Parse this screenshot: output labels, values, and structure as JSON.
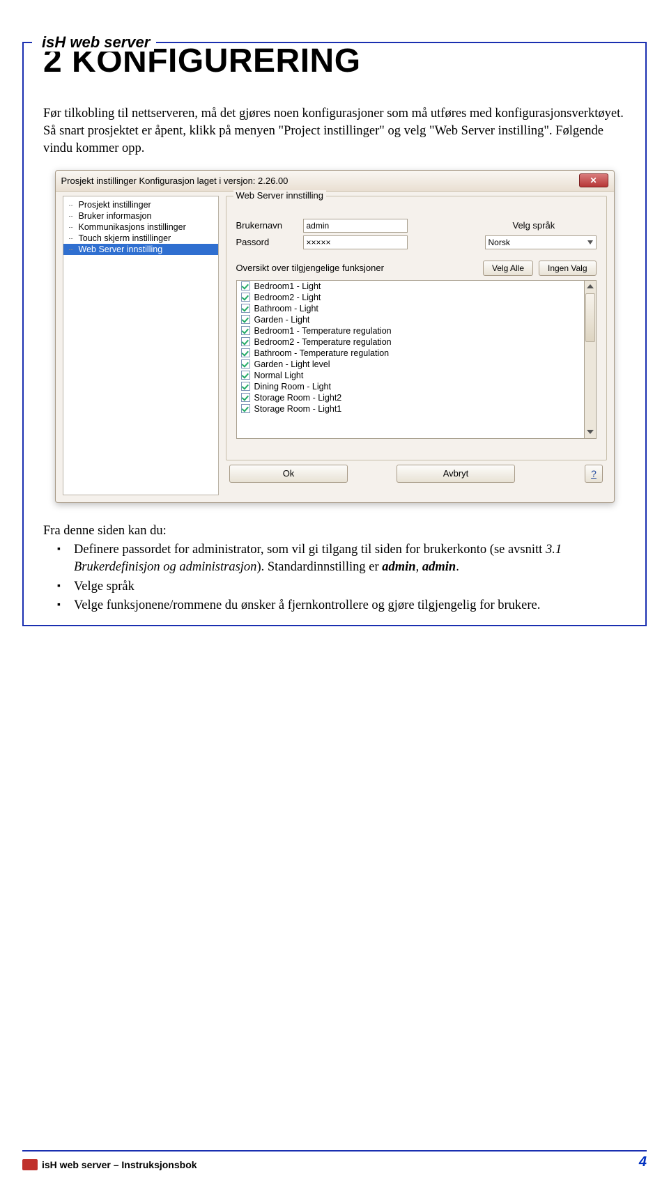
{
  "header_title": "isH web server",
  "h1": "2 KONFIGURERING",
  "intro": "Før tilkobling til nettserveren, må det gjøres noen konfigurasjoner som må utføres med konfigurasjonsverktøyet. Så snart prosjektet er åpent, klikk på menyen \"Project instillinger\" og velg \"Web Server instilling\". Følgende vindu kommer opp.",
  "dialog": {
    "title": "Prosjekt instillinger  Konfigurasjon laget i versjon:  2.26.00",
    "tree": [
      "Prosjekt instillinger",
      "Bruker informasjon",
      "Kommunikasjons instillinger",
      "Touch skjerm instillinger",
      "Web Server innstilling"
    ],
    "tree_selected_index": 4,
    "group_title": "Web Server innstilling",
    "username_label": "Brukernavn",
    "username_value": "admin",
    "password_label": "Passord",
    "password_value": "×××××",
    "lang_label": "Velg språk",
    "lang_value": "Norsk",
    "funcs_label": "Oversikt over tilgjengelige funksjoner",
    "select_all": "Velg Alle",
    "select_none": "Ingen Valg",
    "items": [
      "Bedroom1 - Light",
      "Bedroom2 - Light",
      "Bathroom - Light",
      "Garden - Light",
      "Bedroom1 - Temperature regulation",
      "Bedroom2 - Temperature regulation",
      "Bathroom - Temperature regulation",
      "Garden - Light level",
      "Normal Light",
      "Dining Room - Light",
      "Storage Room - Light2",
      "Storage Room - Light1"
    ],
    "ok": "Ok",
    "cancel": "Avbryt",
    "help": "?"
  },
  "post_intro": "Fra denne siden kan du:",
  "bullets": {
    "b1_a": "Definere passordet for administrator, som vil gi tilgang til siden for brukerkonto (se avsnitt ",
    "b1_i": "3.1 Brukerdefinisjon og administrasjon",
    "b1_b": "). Standardinnstilling er ",
    "b1_bold1": "admin",
    "b1_c": ", ",
    "b1_bold2": "admin",
    "b1_d": ".",
    "b2": "Velge språk",
    "b3": "Velge funksjonene/rommene du ønsker å fjernkontrollere og gjøre tilgjengelig for brukere."
  },
  "footer_text": "isH web server – Instruksjonsbok",
  "page_number": "4"
}
